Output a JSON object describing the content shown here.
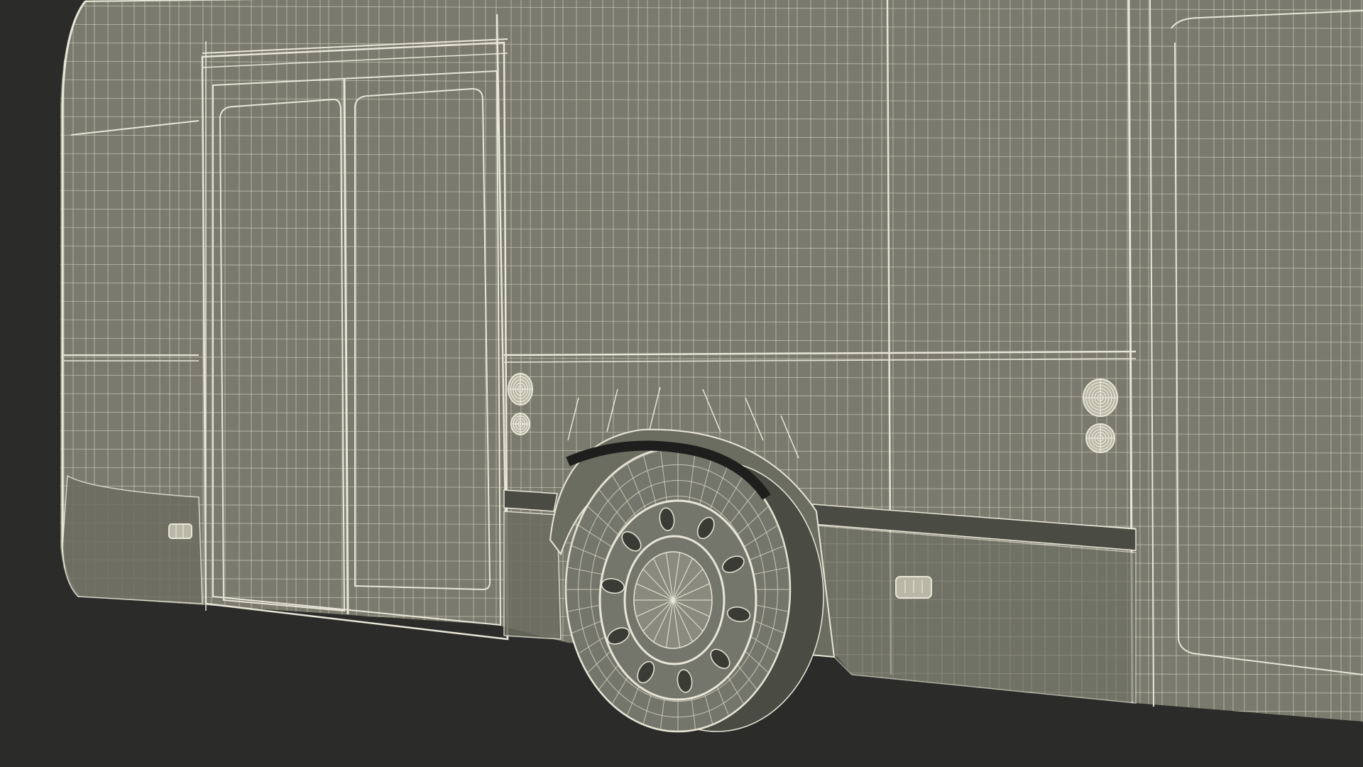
{
  "scene": {
    "subject": "bus-wireframe-render",
    "colors": {
      "background": "#2b2b29",
      "body_fill": "#7a7b6e",
      "body_fill_dark": "#6c6d61",
      "wire": "#e8e6d8",
      "wire_faint": "#d9d7c6",
      "shadow": "#4a4b43",
      "tire_fill": "#75766b",
      "wheel_well": "#2f302c"
    }
  }
}
